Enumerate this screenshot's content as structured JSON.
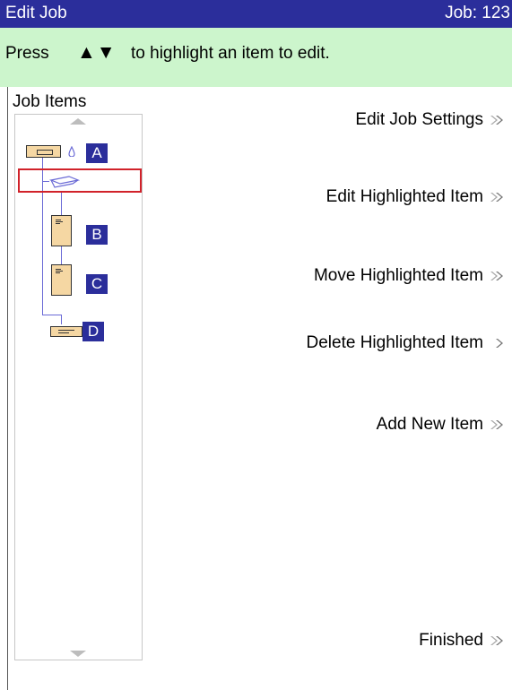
{
  "header": {
    "title": "Edit Job",
    "job_label": "Job:",
    "job_number": "123"
  },
  "instruction": {
    "press": "Press",
    "arrows": "▲▼",
    "rest": "to highlight an item to edit."
  },
  "panel": {
    "label": "Job Items",
    "items": [
      {
        "letter": "A"
      },
      {
        "letter": "B"
      },
      {
        "letter": "C"
      },
      {
        "letter": "D"
      }
    ]
  },
  "actions": [
    {
      "label": "Edit Job Settings"
    },
    {
      "label": "Edit Highlighted Item"
    },
    {
      "label": "Move Highlighted Item"
    },
    {
      "label": "Delete Highlighted Item"
    },
    {
      "label": "Add New Item"
    },
    {
      "label": "Finished"
    }
  ],
  "colors": {
    "title_bg": "#2b2e9b",
    "instruction_bg": "#ccf5cc",
    "highlight": "#d1222a",
    "doc_fill": "#f5d7a3",
    "connector": "#6a6ad6"
  },
  "icons": [
    "envelope-icon",
    "ink-drop-icon",
    "insert-tray-icon",
    "document-icon",
    "chevron-right-icon"
  ]
}
